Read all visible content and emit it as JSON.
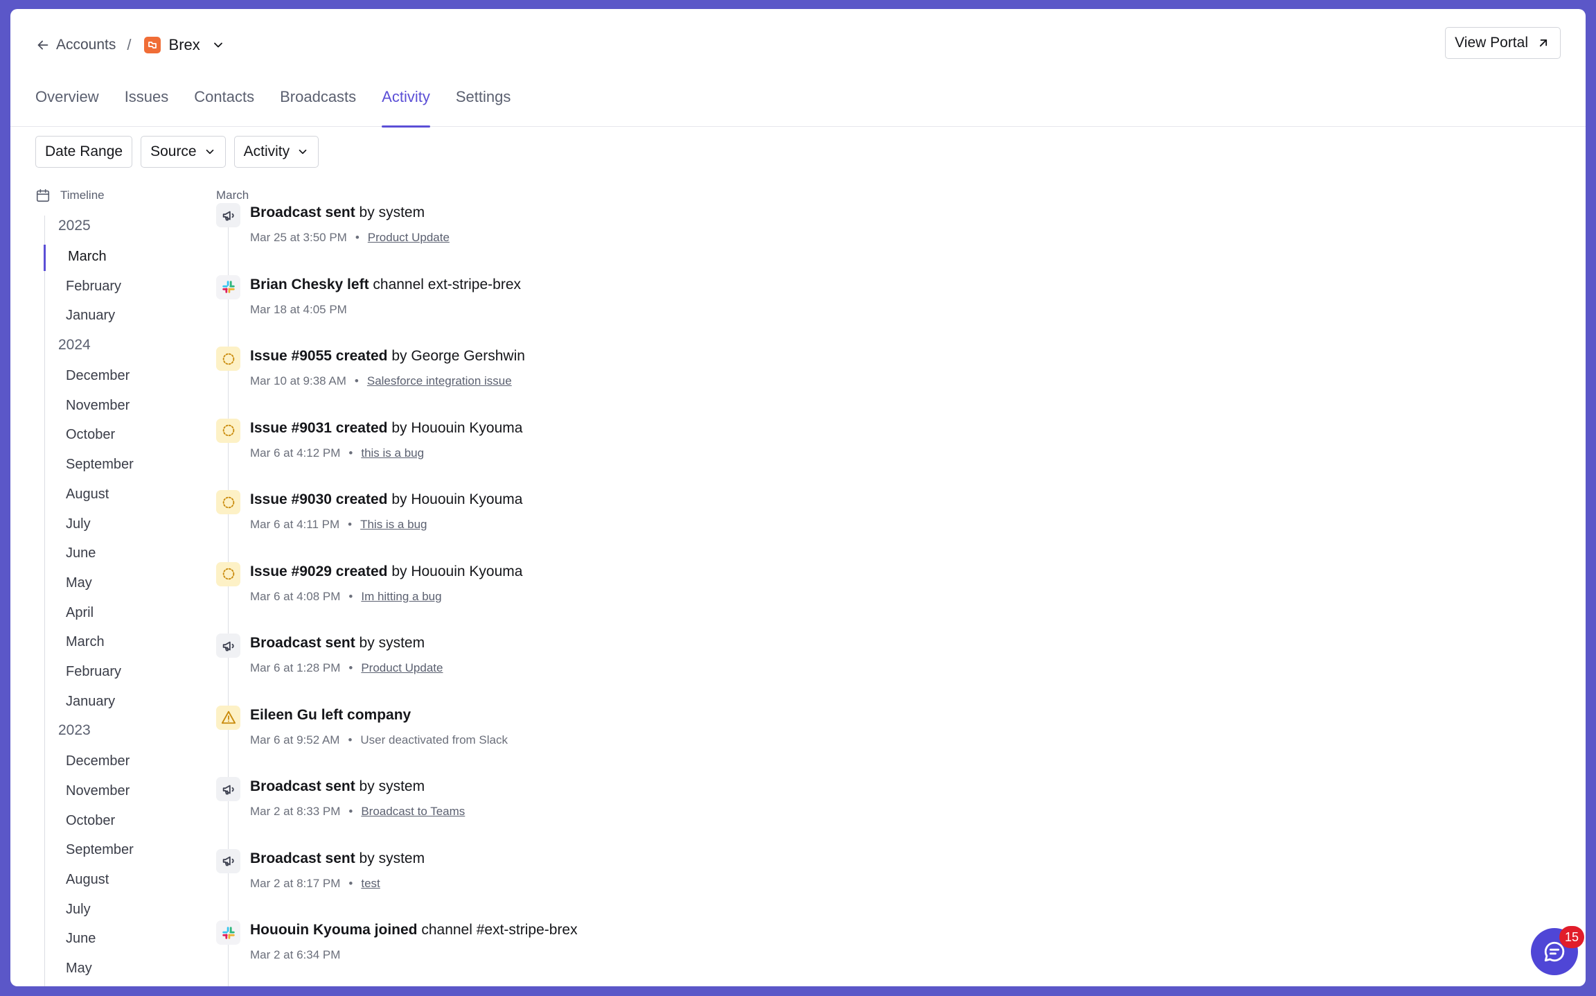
{
  "header": {
    "back_label": "Accounts",
    "separator": "/",
    "account_name": "Brex",
    "view_portal_label": "View Portal"
  },
  "tabs": [
    {
      "label": "Overview",
      "active": false
    },
    {
      "label": "Issues",
      "active": false
    },
    {
      "label": "Contacts",
      "active": false
    },
    {
      "label": "Broadcasts",
      "active": false
    },
    {
      "label": "Activity",
      "active": true
    },
    {
      "label": "Settings",
      "active": false
    }
  ],
  "filters": {
    "date_range": "Date Range",
    "source": "Source",
    "activity": "Activity"
  },
  "timeline": {
    "heading": "Timeline",
    "years": [
      {
        "year": "2025",
        "months": [
          "March",
          "February",
          "January"
        ]
      },
      {
        "year": "2024",
        "months": [
          "December",
          "November",
          "October",
          "September",
          "August",
          "July",
          "June",
          "May",
          "April",
          "March",
          "February",
          "January"
        ]
      },
      {
        "year": "2023",
        "months": [
          "December",
          "November",
          "October",
          "September",
          "August",
          "July",
          "June",
          "May"
        ]
      }
    ],
    "active_month": "March"
  },
  "feed": {
    "month": "March",
    "items": [
      {
        "icon": "megaphone-icon",
        "bold": "Broadcast sent",
        "rest": " by system",
        "time": "Mar 25 at 3:50 PM",
        "link": "Product Update",
        "note": ""
      },
      {
        "icon": "slack-icon",
        "bold": "Brian Chesky left",
        "rest": " channel ext-stripe-brex",
        "time": "Mar 18 at 4:05 PM",
        "link": "",
        "note": ""
      },
      {
        "icon": "issue-icon",
        "bold": "Issue #9055 created",
        "rest": " by George Gershwin",
        "time": "Mar 10 at 9:38 AM",
        "link": "Salesforce integration issue",
        "note": ""
      },
      {
        "icon": "issue-icon",
        "bold": "Issue #9031 created",
        "rest": " by Hououin Kyouma",
        "time": "Mar 6 at 4:12 PM",
        "link": "this is a bug",
        "note": ""
      },
      {
        "icon": "issue-icon",
        "bold": "Issue #9030 created",
        "rest": " by Hououin Kyouma",
        "time": "Mar 6 at 4:11 PM",
        "link": "This is a bug",
        "note": ""
      },
      {
        "icon": "issue-icon",
        "bold": "Issue #9029 created",
        "rest": " by Hououin Kyouma",
        "time": "Mar 6 at 4:08 PM",
        "link": "Im hitting a bug",
        "note": ""
      },
      {
        "icon": "megaphone-icon",
        "bold": "Broadcast sent",
        "rest": " by system",
        "time": "Mar 6 at 1:28 PM",
        "link": "Product Update",
        "note": ""
      },
      {
        "icon": "warning-icon",
        "bold": "Eileen Gu left company",
        "rest": "",
        "time": "Mar 6 at 9:52 AM",
        "link": "",
        "note": "User deactivated from Slack"
      },
      {
        "icon": "megaphone-icon",
        "bold": "Broadcast sent",
        "rest": " by system",
        "time": "Mar 2 at 8:33 PM",
        "link": "Broadcast to Teams",
        "note": ""
      },
      {
        "icon": "megaphone-icon",
        "bold": "Broadcast sent",
        "rest": " by system",
        "time": "Mar 2 at 8:17 PM",
        "link": "test",
        "note": ""
      },
      {
        "icon": "slack-icon",
        "bold": "Hououin Kyouma joined",
        "rest": " channel #ext-stripe-brex",
        "time": "Mar 2 at 6:34 PM",
        "link": "",
        "note": ""
      }
    ]
  },
  "chat": {
    "badge_count": "15"
  },
  "colors": {
    "accent": "#5b4fd6",
    "frame": "#5b57c8",
    "brand_logo": "#f06d36",
    "badge": "#e11d2a",
    "issue_bg": "#fdf1c6"
  }
}
